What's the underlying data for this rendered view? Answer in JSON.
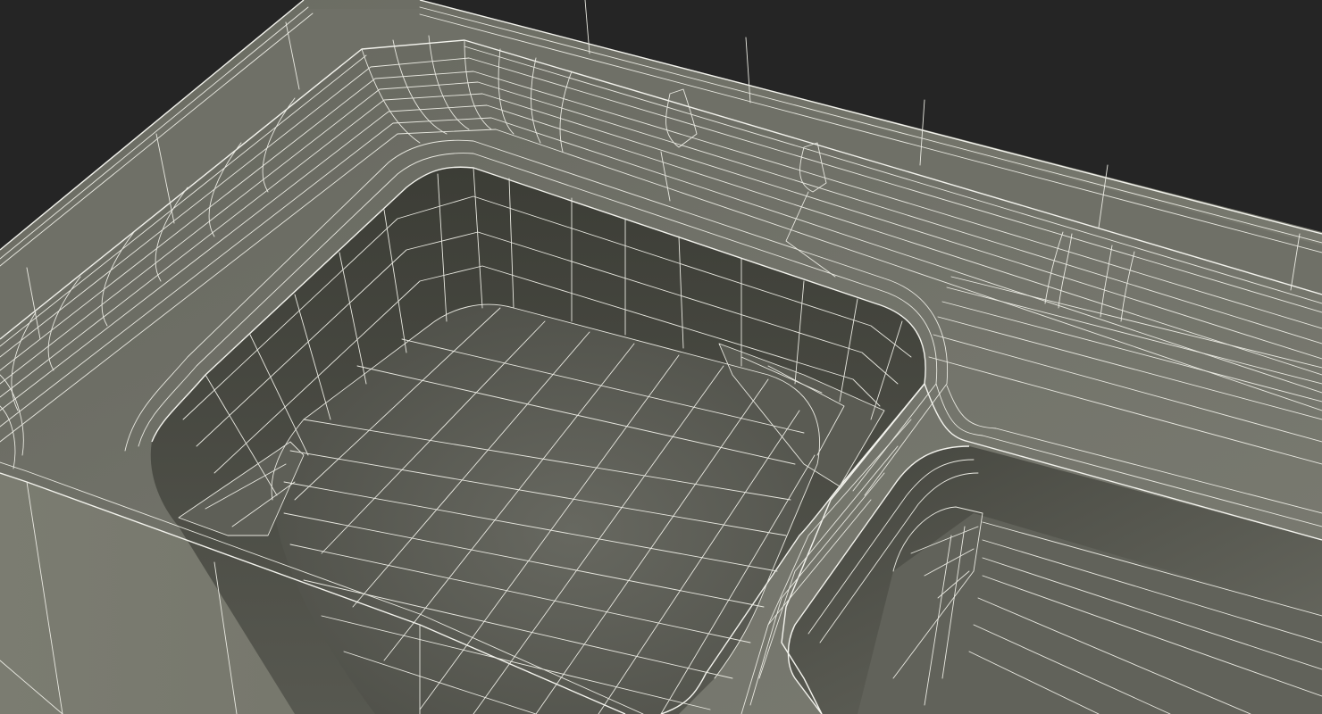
{
  "scene": {
    "subject": "hot-tub-wireframe-render",
    "background_color": "#252525",
    "surface_color_light": "#7a7b70",
    "surface_color_mid": "#5f6057",
    "surface_color_dark": "#3a3b34",
    "wireframe_color": "#e9e9e1",
    "icons": [
      "hot-tub-mesh-icon"
    ]
  }
}
